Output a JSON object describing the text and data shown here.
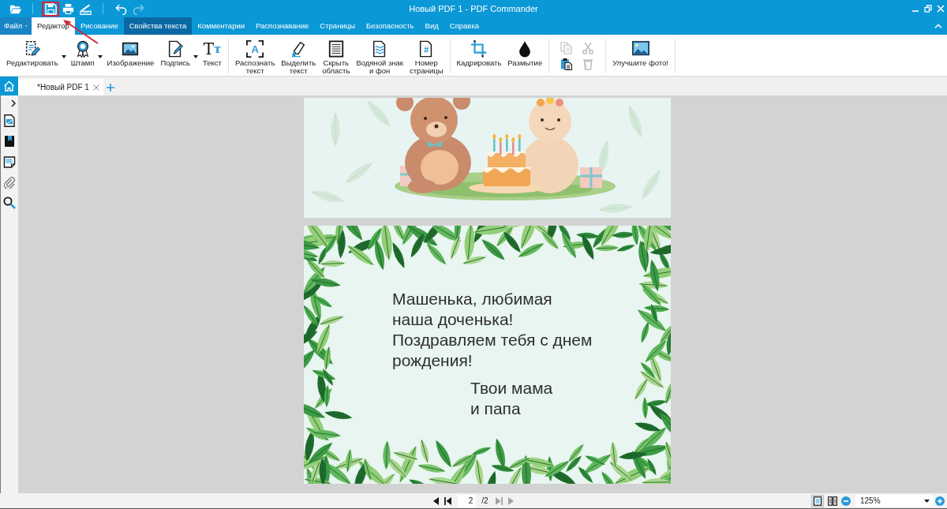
{
  "window": {
    "title": "Новый PDF 1 - PDF Commander"
  },
  "quick_access": [
    {
      "items": [
        {
          "kind": "open",
          "disabled": false,
          "highlighted": false
        }
      ]
    },
    {
      "items": [
        {
          "kind": "save",
          "disabled": false,
          "highlighted": true
        },
        {
          "kind": "print",
          "disabled": false,
          "highlighted": false
        },
        {
          "kind": "scan",
          "disabled": false,
          "highlighted": false
        }
      ]
    },
    {
      "items": [
        {
          "kind": "undo",
          "disabled": false,
          "highlighted": false
        },
        {
          "kind": "redo",
          "disabled": true,
          "highlighted": false
        }
      ]
    }
  ],
  "menu": {
    "file": "Файл",
    "tabs": [
      {
        "label": "Редактор",
        "selected": true,
        "contextual": false
      },
      {
        "label": "Рисование",
        "selected": false,
        "contextual": false
      },
      {
        "label": "Свойства текста",
        "selected": false,
        "contextual": true
      },
      {
        "label": "Комментарии",
        "selected": false,
        "contextual": false
      },
      {
        "label": "Распознавание",
        "selected": false,
        "contextual": false
      },
      {
        "label": "Страницы",
        "selected": false,
        "contextual": false
      },
      {
        "label": "Безопасность",
        "selected": false,
        "contextual": false
      },
      {
        "label": "Вид",
        "selected": false,
        "contextual": false
      },
      {
        "label": "Справка",
        "selected": false,
        "contextual": false
      }
    ]
  },
  "ribbon": {
    "groups": [
      {
        "items": [
          {
            "kind": "edit",
            "label": "Редактировать",
            "dropdown": true
          },
          {
            "kind": "stamp",
            "label": "Штамп",
            "dropdown": true
          },
          {
            "kind": "image",
            "label": "Изображение",
            "dropdown": false
          },
          {
            "kind": "signature",
            "label": "Подпись",
            "dropdown": true
          },
          {
            "kind": "text",
            "label": "Текст",
            "dropdown": false,
            "glyph": "Tт"
          }
        ]
      },
      {
        "items": [
          {
            "kind": "recognize",
            "label": "Распознать\nтекст",
            "dropdown": false,
            "glyph": "A"
          },
          {
            "kind": "highlight",
            "label": "Выделить\nтекст",
            "dropdown": false
          },
          {
            "kind": "hide",
            "label": "Скрыть\nобласть",
            "dropdown": false
          },
          {
            "kind": "watermark",
            "label": "Водяной знак\nи фон",
            "dropdown": false
          },
          {
            "kind": "page_number",
            "label": "Номер\nстраницы",
            "dropdown": false,
            "glyph": "#"
          }
        ]
      },
      {
        "items": [
          {
            "kind": "crop",
            "label": "Кадрировать",
            "dropdown": false
          },
          {
            "kind": "blur",
            "label": "Размытие",
            "dropdown": false
          }
        ]
      },
      {
        "small_items": [
          {
            "kind": "copy",
            "disabled": true
          },
          {
            "kind": "cut",
            "disabled": true
          },
          {
            "kind": "paste",
            "disabled": false
          },
          {
            "kind": "delete",
            "disabled": true
          }
        ]
      },
      {
        "items": [
          {
            "kind": "enhance",
            "label": "Улучшите фото!",
            "dropdown": false
          }
        ]
      }
    ]
  },
  "document_tabs": [
    {
      "label": "*Новый PDF 1",
      "selected": true
    }
  ],
  "document": {
    "pages": [
      {
        "kind": "illustration"
      },
      {
        "kind": "card",
        "greeting": [
          "Машенька, любимая",
          "наша доченька!",
          "Поздравляем тебя с днем",
          "рождения!"
        ],
        "signature": [
          "Твои мама",
          "и папа"
        ]
      }
    ]
  },
  "status_bar": {
    "back": [
      {
        "kind": "previous",
        "disabled": false
      },
      {
        "kind": "first",
        "disabled": false
      }
    ],
    "page": "2",
    "total": "/2",
    "forward": [
      {
        "kind": "last",
        "disabled": true
      },
      {
        "kind": "next",
        "disabled": true
      }
    ],
    "views": [
      {
        "kind": "single",
        "selected": true
      },
      {
        "kind": "two_page",
        "selected": false
      }
    ],
    "zoom": "125%"
  }
}
